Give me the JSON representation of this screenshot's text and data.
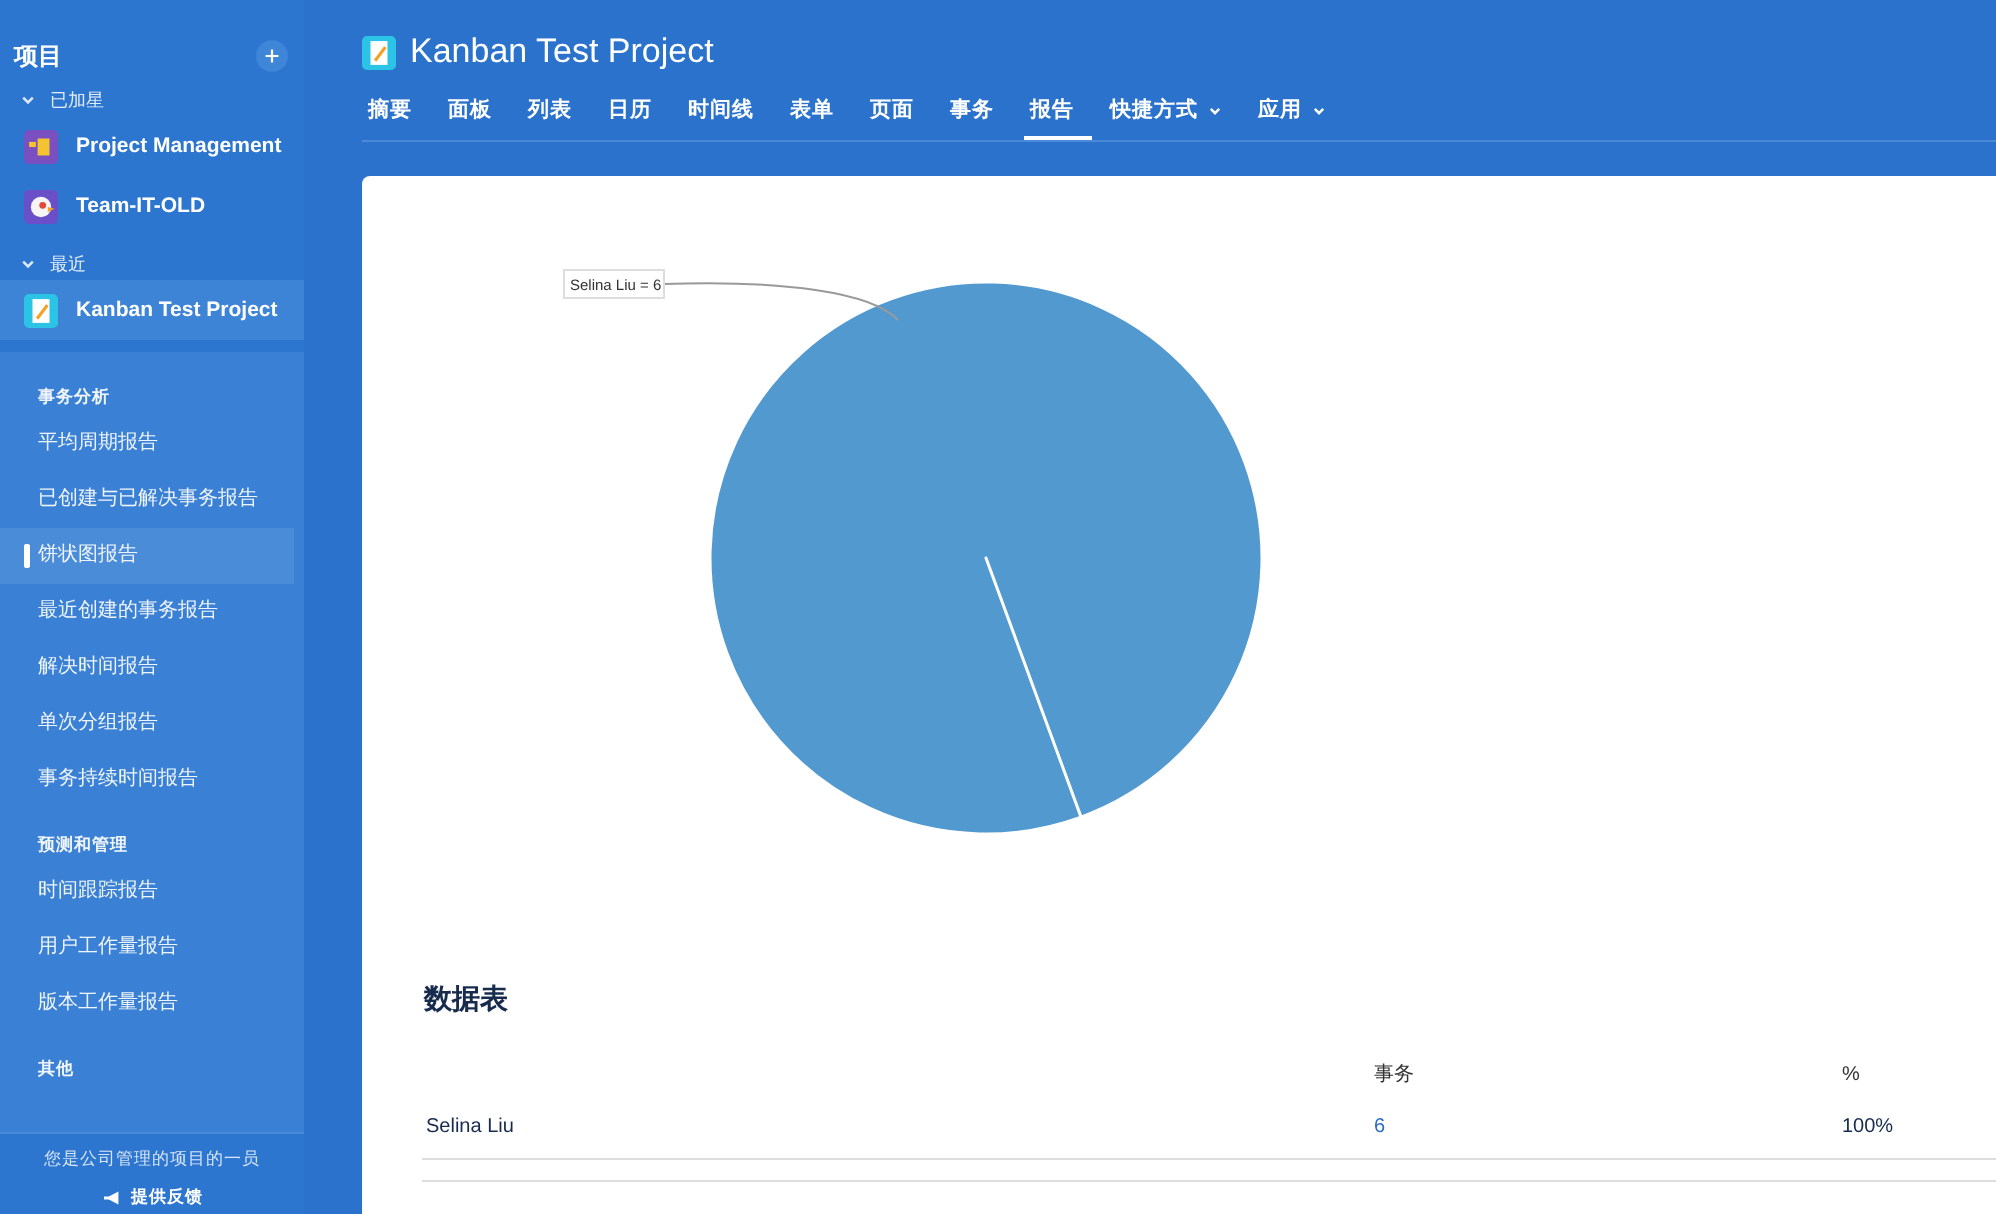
{
  "sidebar": {
    "title": "项目",
    "groups": [
      {
        "label": "已加星",
        "expanded": true,
        "items": [
          {
            "label": "Project Management",
            "kind": "puzzle",
            "selected": false
          },
          {
            "label": "Team-IT-OLD",
            "kind": "bird",
            "selected": false
          }
        ]
      },
      {
        "label": "最近",
        "expanded": true,
        "items": [
          {
            "label": "Kanban Test Project",
            "kind": "notepad",
            "selected": true
          }
        ]
      }
    ],
    "sections": [
      {
        "title": "事务分析",
        "items": [
          {
            "label": "平均周期报告",
            "selected": false
          },
          {
            "label": "已创建与已解决事务报告",
            "selected": false
          },
          {
            "label": "饼状图报告",
            "selected": true
          },
          {
            "label": "最近创建的事务报告",
            "selected": false
          },
          {
            "label": "解决时间报告",
            "selected": false
          },
          {
            "label": "单次分组报告",
            "selected": false
          },
          {
            "label": "事务持续时间报告",
            "selected": false
          }
        ]
      },
      {
        "title": "预测和管理",
        "items": [
          {
            "label": "时间跟踪报告",
            "selected": false
          },
          {
            "label": "用户工作量报告",
            "selected": false
          },
          {
            "label": "版本工作量报告",
            "selected": false
          }
        ]
      },
      {
        "title": "其他"
      }
    ],
    "footer_note": "您是公司管理的项目的一员",
    "feedback": "提供反馈"
  },
  "header": {
    "title": "Kanban Test Project",
    "tabs": [
      {
        "label": "摘要",
        "selected": false,
        "dropdown": false
      },
      {
        "label": "面板",
        "selected": false,
        "dropdown": false
      },
      {
        "label": "列表",
        "selected": false,
        "dropdown": false
      },
      {
        "label": "日历",
        "selected": false,
        "dropdown": false
      },
      {
        "label": "时间线",
        "selected": false,
        "dropdown": false
      },
      {
        "label": "表单",
        "selected": false,
        "dropdown": false
      },
      {
        "label": "页面",
        "selected": false,
        "dropdown": false
      },
      {
        "label": "事务",
        "selected": false,
        "dropdown": false
      },
      {
        "label": "报告",
        "selected": true,
        "dropdown": false
      },
      {
        "label": "快捷方式",
        "selected": false,
        "dropdown": true
      },
      {
        "label": "应用",
        "selected": false,
        "dropdown": true
      }
    ]
  },
  "report": {
    "chart_data": {
      "type": "pie",
      "series": [
        {
          "color": "#5299d0",
          "values": [
            100
          ]
        }
      ],
      "annotations": [
        {
          "text": "Selina Liu = 6"
        }
      ]
    },
    "table": {
      "title": "数据表",
      "columns": [
        "事务",
        "%"
      ],
      "rows": [
        {
          "name": "Selina Liu",
          "count": "6",
          "percent": "100%"
        }
      ]
    }
  }
}
